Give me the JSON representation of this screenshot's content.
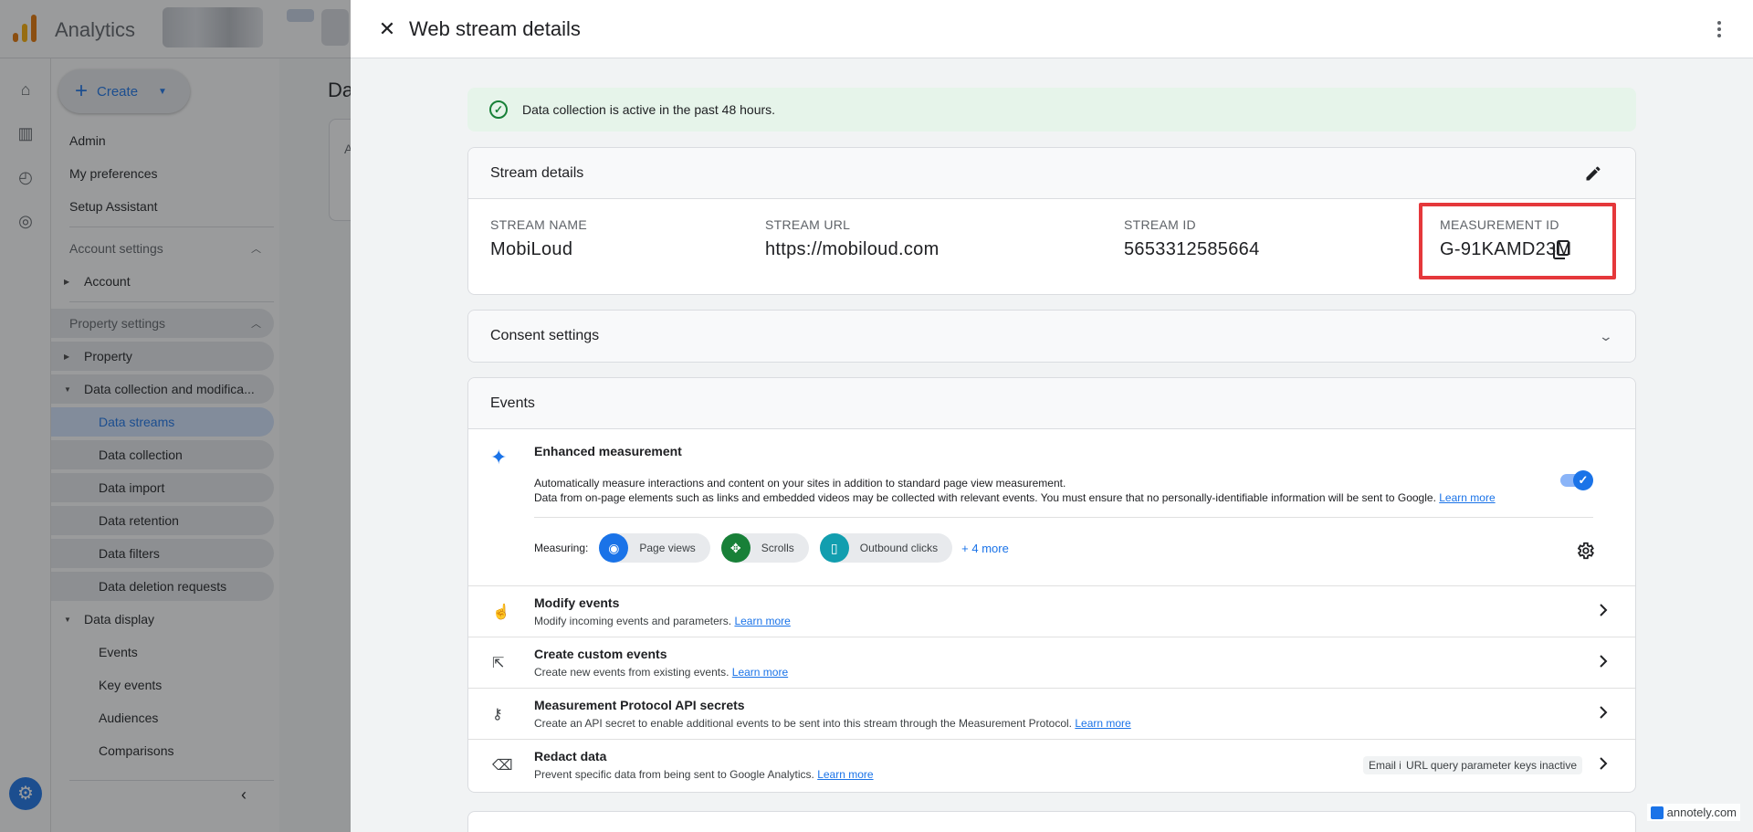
{
  "app": {
    "title": "Analytics",
    "create_label": "Create",
    "main_title_partial": "Da",
    "main_card_partial": "A"
  },
  "sidebar": {
    "items": [
      {
        "label": "Admin"
      },
      {
        "label": "My preferences"
      },
      {
        "label": "Setup Assistant"
      },
      {
        "label": "Account settings",
        "type": "section"
      },
      {
        "label": "Account"
      },
      {
        "label": "Property settings",
        "type": "section"
      },
      {
        "label": "Property"
      },
      {
        "label": "Data collection and modifica..."
      },
      {
        "label": "Data streams",
        "active": true
      },
      {
        "label": "Data collection"
      },
      {
        "label": "Data import"
      },
      {
        "label": "Data retention"
      },
      {
        "label": "Data filters"
      },
      {
        "label": "Data deletion requests"
      },
      {
        "label": "Data display"
      },
      {
        "label": "Events"
      },
      {
        "label": "Key events"
      },
      {
        "label": "Audiences"
      },
      {
        "label": "Comparisons"
      }
    ]
  },
  "panel": {
    "title": "Web stream details",
    "banner": "Data collection is active in the past 48 hours."
  },
  "stream_details": {
    "heading": "Stream details",
    "fields": [
      {
        "label": "STREAM NAME",
        "value": "MobiLoud"
      },
      {
        "label": "STREAM URL",
        "value": "https://mobiloud.com"
      },
      {
        "label": "STREAM ID",
        "value": "5653312585664"
      },
      {
        "label": "MEASUREMENT ID",
        "value": "G-91KAMD23M"
      }
    ]
  },
  "consent": {
    "heading": "Consent settings"
  },
  "events": {
    "heading": "Events",
    "enhanced": {
      "title": "Enhanced measurement",
      "desc1": "Automatically measure interactions and content on your sites in addition to standard page view measurement.",
      "desc2": "Data from on-page elements such as links and embedded videos may be collected with relevant events. You must ensure that no personally-identifiable information will be sent to Google.",
      "learn_more": "Learn more",
      "enabled": true,
      "measuring_label": "Measuring:",
      "chips": [
        {
          "label": "Page views",
          "color": "#1a73e8",
          "icon": "eye-icon"
        },
        {
          "label": "Scrolls",
          "color": "#188038",
          "icon": "scroll-icon"
        },
        {
          "label": "Outbound clicks",
          "color": "#129eaf",
          "icon": "mouse-icon"
        }
      ],
      "more": "+ 4 more"
    },
    "rows": [
      {
        "title": "Modify events",
        "desc": "Modify incoming events and parameters.",
        "link": "Learn more"
      },
      {
        "title": "Create custom events",
        "desc": "Create new events from existing events.",
        "link": "Learn more"
      },
      {
        "title": "Measurement Protocol API secrets",
        "desc": "Create an API secret to enable additional events to be sent into this stream through the Measurement Protocol.",
        "link": "Learn more"
      },
      {
        "title": "Redact data",
        "desc": "Prevent specific data from being sent to Google Analytics.",
        "link": "Learn more",
        "tags": [
          "Email inactive",
          "URL query parameter keys inactive"
        ]
      }
    ]
  },
  "watermark": "annotely.com",
  "colors": {
    "accent": "#1a73e8",
    "success_bg": "#e6f4ea",
    "highlight": "#e5383b"
  }
}
